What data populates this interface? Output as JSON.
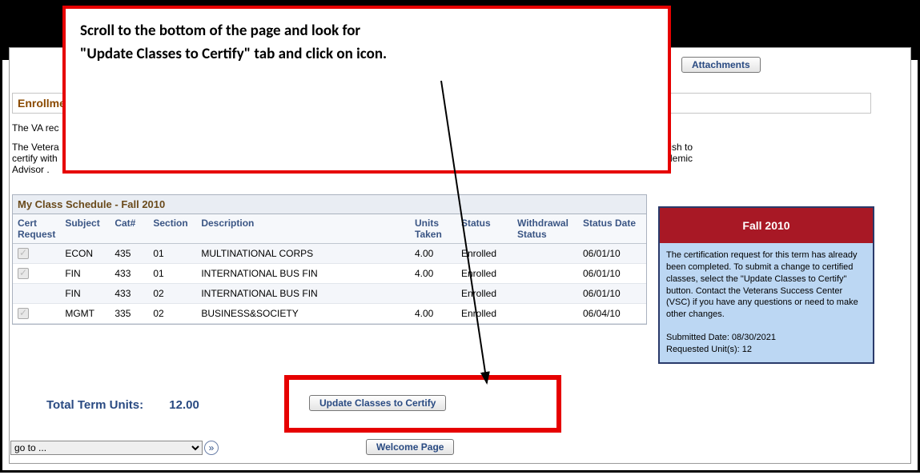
{
  "callout": {
    "line1": "Scroll to the bottom of the page and look for",
    "line2": "\"Update Classes to Certify\" tab and click on icon."
  },
  "buttons": {
    "attachments": "Attachments",
    "update_classes": "Update Classes to Certify",
    "welcome": "Welcome Page"
  },
  "enrollment": {
    "header": "Enrollme",
    "va_line": "The VA rec",
    "para2_frag1": "The Vetera",
    "para2_frag_right1": "f courses you wish to",
    "para2_frag2": "certify with",
    "para2_frag_right2": "ith your Academic",
    "para2_frag3": "Advisor ."
  },
  "schedule": {
    "title": "My Class Schedule - Fall 2010",
    "headers": {
      "cert": "Cert Request",
      "subject": "Subject",
      "cat": "Cat#",
      "section": "Section",
      "desc": "Description",
      "units": "Units Taken",
      "status": "Status",
      "withdrawal": "Withdrawal Status",
      "status_date": "Status Date"
    },
    "rows": [
      {
        "checked": true,
        "subject": "ECON",
        "cat": "435",
        "section": "01",
        "desc": "MULTINATIONAL CORPS",
        "units": "4.00",
        "status": "Enrolled",
        "withdrawal": "",
        "date": "06/01/10"
      },
      {
        "checked": true,
        "subject": "FIN",
        "cat": "433",
        "section": "01",
        "desc": "INTERNATIONAL BUS FIN",
        "units": "4.00",
        "status": "Enrolled",
        "withdrawal": "",
        "date": "06/01/10"
      },
      {
        "checked": false,
        "subject": "FIN",
        "cat": "433",
        "section": "02",
        "desc": "INTERNATIONAL BUS FIN",
        "units": "",
        "status": "Enrolled",
        "withdrawal": "",
        "date": "06/01/10"
      },
      {
        "checked": true,
        "subject": "MGMT",
        "cat": "335",
        "section": "02",
        "desc": "BUSINESS&SOCIETY",
        "units": "4.00",
        "status": "Enrolled",
        "withdrawal": "",
        "date": "06/04/10"
      }
    ]
  },
  "totals": {
    "label": "Total Term Units:",
    "value": "12.00"
  },
  "goto": {
    "placeholder": "go to ...",
    "go_glyph": "»"
  },
  "termbox": {
    "title": "Fall 2010",
    "body": "The certification request for this term has already been completed. To submit a change to certified classes, select the \"Update Classes to Certify\" button. Contact the Veterans Success Center (VSC) if you have any questions or need to make other changes.",
    "submitted": "Submitted Date: 08/30/2021",
    "requested": "Requested Unit(s): 12"
  }
}
